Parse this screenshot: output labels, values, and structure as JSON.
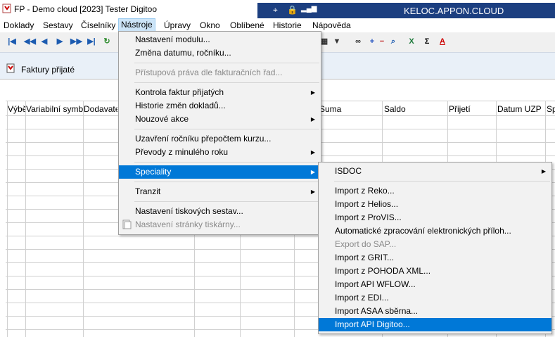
{
  "window": {
    "title": "FP - Demo cloud  [2023]  Tester Digitoo"
  },
  "remote": {
    "title": "KELOC.APPON.CLOUD"
  },
  "menubar": [
    {
      "label": "Doklady"
    },
    {
      "label": "Sestavy"
    },
    {
      "label": "Číselníky"
    },
    {
      "label": "Nástroje"
    },
    {
      "label": "Úpravy"
    },
    {
      "label": "Okno"
    },
    {
      "label": "Oblíbené"
    },
    {
      "label": "Historie"
    },
    {
      "label": "Nápověda"
    }
  ],
  "document": {
    "title": "Faktury přijaté"
  },
  "grid": {
    "columns": [
      "Výběr",
      "Variabilní symbol",
      "Dodavatel",
      "",
      "",
      "Suma",
      "Saldo",
      "Přijetí",
      "Datum UZP",
      "Sp"
    ]
  },
  "tools_menu": {
    "items": [
      {
        "label": "Nastavení modulu...",
        "disabled": false,
        "submenu": false
      },
      {
        "label": "Změna datumu, ročníku...",
        "disabled": false,
        "submenu": false
      },
      {
        "label": "Přístupová práva dle fakturačních řad...",
        "disabled": true,
        "submenu": false
      },
      {
        "label": "Kontrola faktur přijatých",
        "disabled": false,
        "submenu": true
      },
      {
        "label": "Historie změn dokladů...",
        "disabled": false,
        "submenu": false
      },
      {
        "label": "Nouzové akce",
        "disabled": false,
        "submenu": true
      },
      {
        "label": "Uzavření ročníku přepočtem kurzu...",
        "disabled": false,
        "submenu": false
      },
      {
        "label": "Převody z minulého roku",
        "disabled": false,
        "submenu": true
      },
      {
        "label": "Speciality",
        "disabled": false,
        "submenu": true,
        "selected": true
      },
      {
        "label": "Tranzit",
        "disabled": false,
        "submenu": true
      },
      {
        "label": "Nastavení tiskových sestav...",
        "disabled": false,
        "submenu": false
      },
      {
        "label": "Nastavení stránky tiskárny...",
        "disabled": true,
        "submenu": false
      }
    ]
  },
  "speciality_menu": {
    "items": [
      {
        "label": "ISDOC",
        "submenu": true
      },
      {
        "label": "Import z Reko..."
      },
      {
        "label": "Import z Helios..."
      },
      {
        "label": "Import z ProVIS..."
      },
      {
        "label": "Automatické zpracování elektronických příloh..."
      },
      {
        "label": "Export do SAP...",
        "disabled": true
      },
      {
        "label": "Import z GRIT..."
      },
      {
        "label": "Import z POHODA XML..."
      },
      {
        "label": "Import API WFLOW..."
      },
      {
        "label": "Import z EDI..."
      },
      {
        "label": "Import ASAA sběrna..."
      },
      {
        "label": "Import API Digitoo...",
        "selected": true
      }
    ]
  },
  "icons": {
    "arrow": "▶",
    "sigma": "Σ"
  }
}
